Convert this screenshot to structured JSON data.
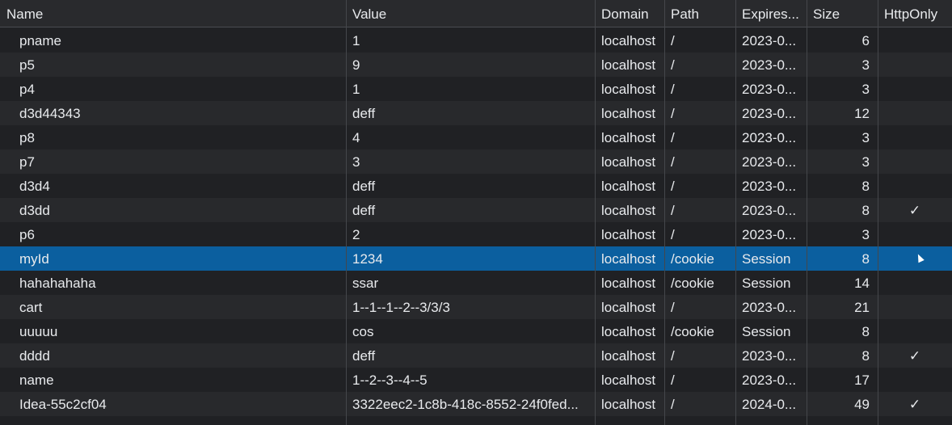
{
  "columns": [
    "Name",
    "Value",
    "Domain",
    "Path",
    "Expires...",
    "Size",
    "HttpOnly"
  ],
  "check_glyph": "✓",
  "selected_row": 9,
  "rows": [
    {
      "name": "pname",
      "value": "1",
      "domain": "localhost",
      "path": "/",
      "expires": "2023-0...",
      "size": "6",
      "httponly": ""
    },
    {
      "name": "p5",
      "value": "9",
      "domain": "localhost",
      "path": "/",
      "expires": "2023-0...",
      "size": "3",
      "httponly": ""
    },
    {
      "name": "p4",
      "value": "1",
      "domain": "localhost",
      "path": "/",
      "expires": "2023-0...",
      "size": "3",
      "httponly": ""
    },
    {
      "name": "d3d44343",
      "value": "deff",
      "domain": "localhost",
      "path": "/",
      "expires": "2023-0...",
      "size": "12",
      "httponly": ""
    },
    {
      "name": "p8",
      "value": "4",
      "domain": "localhost",
      "path": "/",
      "expires": "2023-0...",
      "size": "3",
      "httponly": ""
    },
    {
      "name": "p7",
      "value": "3",
      "domain": "localhost",
      "path": "/",
      "expires": "2023-0...",
      "size": "3",
      "httponly": ""
    },
    {
      "name": "d3d4",
      "value": "deff",
      "domain": "localhost",
      "path": "/",
      "expires": "2023-0...",
      "size": "8",
      "httponly": ""
    },
    {
      "name": "d3dd",
      "value": "deff",
      "domain": "localhost",
      "path": "/",
      "expires": "2023-0...",
      "size": "8",
      "httponly": "✓"
    },
    {
      "name": "p6",
      "value": "2",
      "domain": "localhost",
      "path": "/",
      "expires": "2023-0...",
      "size": "3",
      "httponly": ""
    },
    {
      "name": "myId",
      "value": "1234",
      "domain": "localhost",
      "path": "/cookie",
      "expires": "Session",
      "size": "8",
      "httponly": ""
    },
    {
      "name": "hahahahaha",
      "value": "ssar",
      "domain": "localhost",
      "path": "/cookie",
      "expires": "Session",
      "size": "14",
      "httponly": ""
    },
    {
      "name": "cart",
      "value": "1--1--1--2--3/3/3",
      "domain": "localhost",
      "path": "/",
      "expires": "2023-0...",
      "size": "21",
      "httponly": ""
    },
    {
      "name": "uuuuu",
      "value": "cos",
      "domain": "localhost",
      "path": "/cookie",
      "expires": "Session",
      "size": "8",
      "httponly": ""
    },
    {
      "name": "dddd",
      "value": "deff",
      "domain": "localhost",
      "path": "/",
      "expires": "2023-0...",
      "size": "8",
      "httponly": "✓"
    },
    {
      "name": "name",
      "value": "1--2--3--4--5",
      "domain": "localhost",
      "path": "/",
      "expires": "2023-0...",
      "size": "17",
      "httponly": ""
    },
    {
      "name": "Idea-55c2cf04",
      "value": "3322eec2-1c8b-418c-8552-24f0fed...",
      "domain": "localhost",
      "path": "/",
      "expires": "2024-0...",
      "size": "49",
      "httponly": "✓"
    }
  ]
}
